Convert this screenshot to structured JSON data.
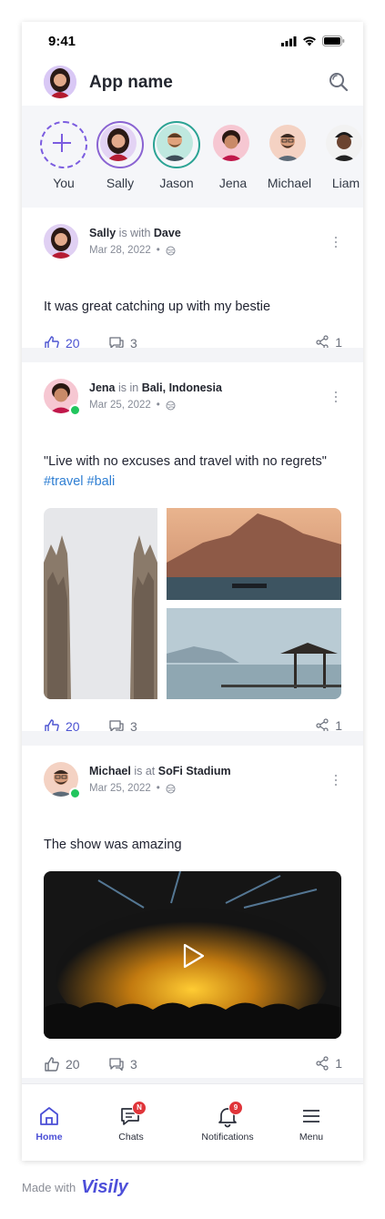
{
  "status_bar": {
    "time": "9:41"
  },
  "header": {
    "title": "App name"
  },
  "stories": [
    {
      "name": "You",
      "add": true
    },
    {
      "name": "Sally",
      "ring": "#8a63d2"
    },
    {
      "name": "Jason",
      "ring": "#2ba394"
    },
    {
      "name": "Jena"
    },
    {
      "name": "Michael"
    },
    {
      "name": "Liam"
    }
  ],
  "posts": [
    {
      "author": "Sally",
      "connector": "is with",
      "target": "Dave",
      "date": "Mar 28, 2022",
      "text": "It was great catching up with my bestie",
      "likes": "20",
      "comments": "3",
      "shares": "1"
    },
    {
      "author": "Jena",
      "connector": "is in",
      "target": "Bali, Indonesia",
      "date": "Mar 25, 2022",
      "text": "\"Live with no excuses and travel with no regrets\"",
      "hashtags": "#travel #bali",
      "likes": "20",
      "comments": "3",
      "shares": "1"
    },
    {
      "author": "Michael",
      "connector": "is at",
      "target": "SoFi Stadium",
      "date": "Mar 25, 2022",
      "text": "The show was amazing",
      "likes": "20",
      "comments": "3",
      "shares": "1"
    }
  ],
  "nav": {
    "home": "Home",
    "chats": "Chats",
    "chats_badge": "N",
    "notifications": "Notifications",
    "notifications_badge": "9",
    "menu": "Menu"
  },
  "footer": {
    "made_with": "Made with",
    "brand": "Visily"
  },
  "colors": {
    "accent": "#4b4fd6",
    "online": "#21c55d",
    "badge": "#e0353a",
    "hashtag": "#2f7fd3"
  }
}
